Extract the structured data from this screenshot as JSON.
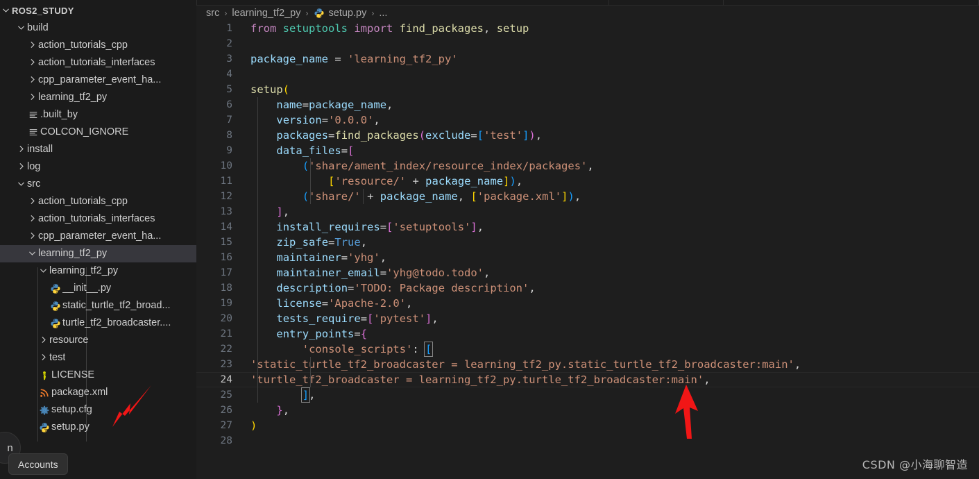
{
  "sidebar": {
    "root": {
      "label": "ROS2_STUDY",
      "icon": "chevron-down-icon",
      "expanded": true
    },
    "items": [
      {
        "label": "build",
        "depth": 1,
        "type": "folder",
        "state": "expanded",
        "icon": "chevron-down-icon"
      },
      {
        "label": "action_tutorials_cpp",
        "depth": 2,
        "type": "folder",
        "state": "collapsed",
        "icon": "chevron-right-icon"
      },
      {
        "label": "action_tutorials_interfaces",
        "depth": 2,
        "type": "folder",
        "state": "collapsed",
        "icon": "chevron-right-icon"
      },
      {
        "label": "cpp_parameter_event_ha...",
        "depth": 2,
        "type": "folder",
        "state": "collapsed",
        "icon": "chevron-right-icon"
      },
      {
        "label": "learning_tf2_py",
        "depth": 2,
        "type": "folder",
        "state": "collapsed",
        "icon": "chevron-right-icon"
      },
      {
        "label": ".built_by",
        "depth": 2,
        "type": "file",
        "icon": "text-file-icon"
      },
      {
        "label": "COLCON_IGNORE",
        "depth": 2,
        "type": "file",
        "icon": "text-file-icon"
      },
      {
        "label": "install",
        "depth": 1,
        "type": "folder",
        "state": "collapsed",
        "icon": "chevron-right-icon"
      },
      {
        "label": "log",
        "depth": 1,
        "type": "folder",
        "state": "collapsed",
        "icon": "chevron-right-icon"
      },
      {
        "label": "src",
        "depth": 1,
        "type": "folder",
        "state": "expanded",
        "icon": "chevron-down-icon"
      },
      {
        "label": "action_tutorials_cpp",
        "depth": 2,
        "type": "folder",
        "state": "collapsed",
        "icon": "chevron-right-icon"
      },
      {
        "label": "action_tutorials_interfaces",
        "depth": 2,
        "type": "folder",
        "state": "collapsed",
        "icon": "chevron-right-icon"
      },
      {
        "label": "cpp_parameter_event_ha...",
        "depth": 2,
        "type": "folder",
        "state": "collapsed",
        "icon": "chevron-right-icon"
      },
      {
        "label": "learning_tf2_py",
        "depth": 2,
        "type": "folder",
        "state": "expanded",
        "icon": "chevron-down-icon",
        "selected": true
      },
      {
        "label": "learning_tf2_py",
        "depth": 3,
        "type": "folder",
        "state": "expanded",
        "icon": "chevron-down-icon"
      },
      {
        "label": "__init__.py",
        "depth": 4,
        "type": "file",
        "icon": "python-file-icon"
      },
      {
        "label": "static_turtle_tf2_broad...",
        "depth": 4,
        "type": "file",
        "icon": "python-file-icon"
      },
      {
        "label": "turtle_tf2_broadcaster....",
        "depth": 4,
        "type": "file",
        "icon": "python-file-icon"
      },
      {
        "label": "resource",
        "depth": 3,
        "type": "folder",
        "state": "collapsed",
        "icon": "chevron-right-icon"
      },
      {
        "label": "test",
        "depth": 3,
        "type": "folder",
        "state": "collapsed",
        "icon": "chevron-right-icon"
      },
      {
        "label": "LICENSE",
        "depth": 3,
        "type": "file",
        "icon": "license-key-icon"
      },
      {
        "label": "package.xml",
        "depth": 3,
        "type": "file",
        "icon": "xml-file-icon"
      },
      {
        "label": "setup.cfg",
        "depth": 3,
        "type": "file",
        "icon": "gear-config-icon"
      },
      {
        "label": "setup.py",
        "depth": 3,
        "type": "file",
        "icon": "python-file-icon"
      }
    ],
    "accounts_tooltip": "Accounts",
    "accounts_icon": "accounts-avatar-icon"
  },
  "breadcrumb": {
    "parts": [
      "src",
      "learning_tf2_py",
      "setup.py",
      "..."
    ],
    "separator": "›",
    "file_icon": "python-file-icon"
  },
  "editor": {
    "active_line": 24,
    "total_lines": 28,
    "lines": [
      {
        "n": 1,
        "text": "from setuptools import find_packages, setup"
      },
      {
        "n": 2,
        "text": ""
      },
      {
        "n": 3,
        "text": "package_name = 'learning_tf2_py'"
      },
      {
        "n": 4,
        "text": ""
      },
      {
        "n": 5,
        "text": "setup("
      },
      {
        "n": 6,
        "text": "    name=package_name,"
      },
      {
        "n": 7,
        "text": "    version='0.0.0',"
      },
      {
        "n": 8,
        "text": "    packages=find_packages(exclude=['test']),"
      },
      {
        "n": 9,
        "text": "    data_files=["
      },
      {
        "n": 10,
        "text": "        ('share/ament_index/resource_index/packages',"
      },
      {
        "n": 11,
        "text": "            ['resource/' + package_name]),"
      },
      {
        "n": 12,
        "text": "        ('share/' + package_name, ['package.xml']),"
      },
      {
        "n": 13,
        "text": "    ],"
      },
      {
        "n": 14,
        "text": "    install_requires=['setuptools'],"
      },
      {
        "n": 15,
        "text": "    zip_safe=True,"
      },
      {
        "n": 16,
        "text": "    maintainer='yhg',"
      },
      {
        "n": 17,
        "text": "    maintainer_email='yhg@todo.todo',"
      },
      {
        "n": 18,
        "text": "    description='TODO: Package description',"
      },
      {
        "n": 19,
        "text": "    license='Apache-2.0',"
      },
      {
        "n": 20,
        "text": "    tests_require=['pytest'],"
      },
      {
        "n": 21,
        "text": "    entry_points={"
      },
      {
        "n": 22,
        "text": "        'console_scripts': ["
      },
      {
        "n": 23,
        "text": "'static_turtle_tf2_broadcaster = learning_tf2_py.static_turtle_tf2_broadcaster:main',"
      },
      {
        "n": 24,
        "text": "'turtle_tf2_broadcaster = learning_tf2_py.turtle_tf2_broadcaster:main',"
      },
      {
        "n": 25,
        "text": "        ],"
      },
      {
        "n": 26,
        "text": "    },"
      },
      {
        "n": 27,
        "text": ")"
      },
      {
        "n": 28,
        "text": ""
      }
    ]
  },
  "annotations": [
    {
      "name": "arrow-to-setup-py",
      "color": "#f11616",
      "points_to": "setup.py"
    },
    {
      "name": "arrow-to-line-24",
      "color": "#f11616",
      "points_to": "line 24"
    }
  ],
  "watermark": {
    "text": "CSDN @小海聊智造"
  },
  "colors": {
    "editor_bg": "#1e1e1e",
    "sidebar_bg": "#1b1b1b",
    "selection_bg": "#37373d",
    "keyword": "#c586c0",
    "builtin": "#569cd6",
    "function": "#dcdcaa",
    "variable": "#9cdcfe",
    "string": "#ce9178",
    "number": "#b5cea8",
    "class": "#4ec9b0",
    "bracket1": "#ffd700",
    "bracket2": "#da70d6",
    "bracket3": "#179fff",
    "annotation_red": "#f11616"
  }
}
